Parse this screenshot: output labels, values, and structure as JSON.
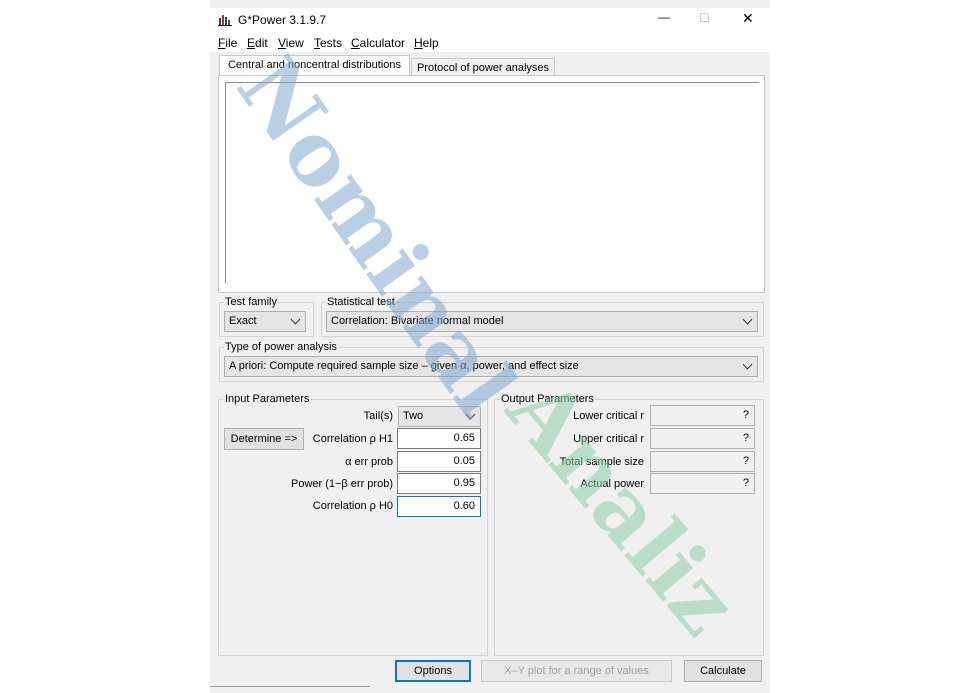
{
  "window": {
    "title": "G*Power 3.1.9.7",
    "controls": {
      "minimize": "—",
      "maximize": "□",
      "close": "✕"
    }
  },
  "menu": {
    "items": [
      {
        "underline": "F",
        "rest": "ile"
      },
      {
        "underline": "E",
        "rest": "dit"
      },
      {
        "underline": "V",
        "rest": "iew"
      },
      {
        "underline": "T",
        "rest": "ests"
      },
      {
        "underline": "C",
        "rest": "alculator"
      },
      {
        "underline": "H",
        "rest": "elp"
      }
    ]
  },
  "tabs": [
    {
      "label": "Central and noncentral distributions",
      "active": true
    },
    {
      "label": "Protocol of power analyses",
      "active": false
    }
  ],
  "test_family": {
    "label": "Test family",
    "value": "Exact"
  },
  "statistical_test": {
    "label": "Statistical test",
    "value": "Correlation: Bivariate normal model"
  },
  "power_analysis_type": {
    "label": "Type of power analysis",
    "value": "A priori: Compute required sample size – given α, power, and effect size"
  },
  "input_parameters": {
    "title": "Input Parameters",
    "determine_button": "Determine =>",
    "tails": {
      "label": "Tail(s)",
      "value": "Two"
    },
    "corr_h1": {
      "label": "Correlation ρ H1",
      "value": "0.65"
    },
    "alpha": {
      "label": "α err prob",
      "value": "0.05"
    },
    "power": {
      "label": "Power (1−β err prob)",
      "value": "0.95"
    },
    "corr_h0": {
      "label": "Correlation ρ H0",
      "value": "0.60"
    }
  },
  "output_parameters": {
    "title": "Output Parameters",
    "lower_critical_r": {
      "label": "Lower critical r",
      "value": "?"
    },
    "upper_critical_r": {
      "label": "Upper critical r",
      "value": "?"
    },
    "total_sample_size": {
      "label": "Total sample size",
      "value": "?"
    },
    "actual_power": {
      "label": "Actual power",
      "value": "?"
    }
  },
  "buttons": {
    "options": "Options",
    "xy_plot": "X–Y plot for a range of values",
    "calculate": "Calculate"
  },
  "watermark": {
    "line1": "Nominal",
    "line2": "Analiz",
    "color1": "#7fa9cf",
    "color2": "#8fcfa8"
  }
}
